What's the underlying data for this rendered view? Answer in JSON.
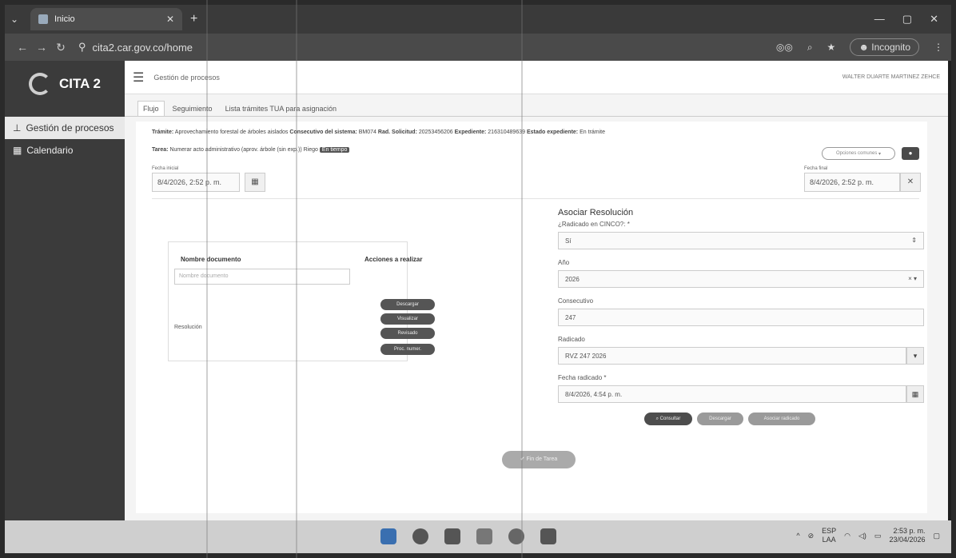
{
  "browser": {
    "tab_title": "Inicio",
    "url": "cita2.car.gov.co/home",
    "incognito_label": "Incognito"
  },
  "app": {
    "name": "CITA 2",
    "topbar_title": "Gestión de procesos",
    "user_name": "WALTER DUARTE MARTINEZ ZEHCE"
  },
  "sidebar": {
    "items": [
      {
        "label": "Gestión de procesos"
      },
      {
        "label": "Calendario"
      }
    ]
  },
  "tabs": [
    {
      "label": "Flujo"
    },
    {
      "label": "Seguimiento"
    },
    {
      "label": "Lista trámites TUA para asignación"
    }
  ],
  "info": {
    "tramite_label": "Trámite:",
    "tramite_value": "Aprovechamiento forestal de árboles aislados",
    "consec_label": "Consecutivo del sistema:",
    "consec_value": "BM074",
    "rad_label": "Rad. Solicitud:",
    "rad_value": "20253456206",
    "exp_label": "Expediente:",
    "exp_value": "216310489639",
    "estado_label": "Estado expediente:",
    "estado_value": "En trámite",
    "tarea_label": "Tarea:",
    "tarea_value": "Numerar acto administrativo (aprov. árbole (sin exp.)) Riego",
    "tarea_tag": "En tiempo",
    "options_label": "Opciones comunes"
  },
  "dates": {
    "start_label": "Fecha inicial",
    "start_value": "8/4/2026, 2:52 p. m.",
    "end_label": "Fecha final",
    "end_value": "8/4/2026, 2:52 p. m."
  },
  "documents": {
    "col_name": "Nombre documento",
    "col_actions": "Acciones a realizar",
    "search_placeholder": "Nombre documento",
    "row_name": "Resolución",
    "actions": [
      "Descargar",
      "Visualizar",
      "Revisado",
      "Proc. numer."
    ]
  },
  "resolution": {
    "title": "Asociar Resolución",
    "radicado_label": "¿Radicado en CINCO?: *",
    "radicado_value": "Sí",
    "year_label": "Año",
    "year_value": "2026",
    "consec_label": "Consecutivo",
    "consec_value": "247",
    "radicado_num_label": "Radicado",
    "radicado_num_value": "RVZ 247 2026",
    "fecha_label": "Fecha radicado *",
    "fecha_value": "8/4/2026, 4:54 p. m.",
    "btn_consultar": "Consultar",
    "btn_middle": "Descargar",
    "btn_asociar": "Asociar radicado"
  },
  "final_button": "Fin de Tarea",
  "taskbar": {
    "lang_top": "ESP",
    "lang_bottom": "LAA",
    "time": "2:53 p. m.",
    "date": "23/04/2026"
  }
}
